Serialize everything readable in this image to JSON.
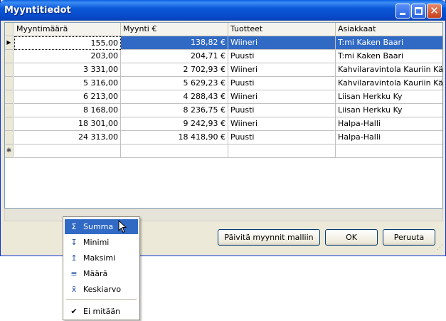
{
  "window": {
    "title": "Myyntitiedot"
  },
  "grid": {
    "columns": [
      "Myyntimäärä",
      "Myynti €",
      "Tuotteet",
      "Asiakkaat"
    ],
    "rows": [
      [
        "155,00",
        "138,82 €",
        "Wiineri",
        "T:mi Kaken Baari"
      ],
      [
        "203,00",
        "204,71 €",
        "Puusti",
        "T:mi Kaken Baari"
      ],
      [
        "3 331,00",
        "2 702,93 €",
        "Wiineri",
        "Kahvilaravintola Kauriin Kää…"
      ],
      [
        "5 316,00",
        "5 629,23 €",
        "Puusti",
        "Kahvilaravintola Kauriin Kää…"
      ],
      [
        "6 213,00",
        "4 288,43 €",
        "Wiineri",
        "Liisan Herkku Ky"
      ],
      [
        "8 168,00",
        "8 236,75 €",
        "Puusti",
        "Liisan Herkku Ky"
      ],
      [
        "18 301,00",
        "9 242,93 €",
        "Wiineri",
        "Halpa-Halli"
      ],
      [
        "24 313,00",
        "18 418,90 €",
        "Puusti",
        "Halpa-Halli"
      ]
    ],
    "current_row_marker": "▶",
    "new_row_marker": "✱"
  },
  "buttons": {
    "update": "Päivitä myynnit malliin",
    "ok": "OK",
    "cancel": "Peruuta"
  },
  "context_menu": {
    "items": [
      {
        "label": "Summa",
        "icon": "sigma-icon"
      },
      {
        "label": "Minimi",
        "icon": "minimum-icon"
      },
      {
        "label": "Maksimi",
        "icon": "maximum-icon"
      },
      {
        "label": "Määrä",
        "icon": "count-icon"
      },
      {
        "label": "Keskiarvo",
        "icon": "average-icon"
      },
      {
        "label": "Ei mitään",
        "icon": "check-icon"
      }
    ]
  },
  "colors": {
    "selection": "#316ac5",
    "title_bar": "#0a58d8"
  }
}
